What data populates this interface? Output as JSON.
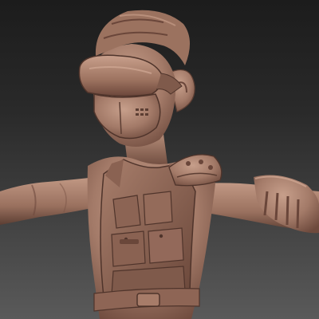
{
  "scene": {
    "background_top": "#1c1c1c",
    "background_bottom": "#5a5a5a",
    "clay_color": "#a37a68",
    "clay_shadow": "#5b3d32",
    "clay_highlight": "#d2aa96"
  },
  "model": {
    "pose": "T-pose",
    "parts": [
      "hair",
      "goggles",
      "face-mask",
      "ear",
      "neck",
      "torso-vest",
      "shoulder-pad",
      "left-arm",
      "right-arm",
      "belt"
    ]
  }
}
